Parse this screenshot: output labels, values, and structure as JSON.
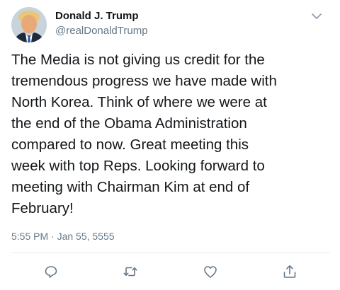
{
  "tweet": {
    "author": {
      "name": "Donald J. Trump",
      "handle": "@realDonaldTrump"
    },
    "text": "The Media is not giving us credit for the\ntremendous progress we have made with\nNorth Korea. Think of where we were at\nthe end of the Obama Administration\ncompared to now. Great meeting this\nweek with top Reps. Looking forward to\nmeeting with Chairman Kim at end of\nFebruary!",
    "timestamp": "5:55 PM · Jan 55, 5555"
  },
  "icons": {
    "menu": "chevron-down-icon",
    "reply": "reply-icon",
    "retweet": "retweet-icon",
    "like": "heart-icon",
    "share": "share-icon"
  },
  "colors": {
    "primary_text": "#14171a",
    "secondary_text": "#657786",
    "divider": "#e6ecf0"
  }
}
